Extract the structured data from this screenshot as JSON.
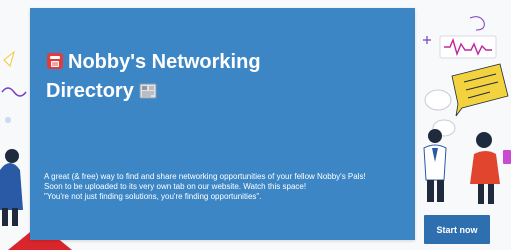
{
  "card": {
    "title": "Nobby's Networking Directory",
    "title_leading_icon": "telephone-icon",
    "title_trailing_icon": "newspaper-icon",
    "description_lines": [
      "A great (& free) way to find and share networking opportunities of your fellow Nobby's Pals!",
      "Soon to be uploaded to its very own tab on our website. Watch this space!",
      "\"You're not just finding solutions, you're finding opportunities\"."
    ]
  },
  "actions": {
    "start_label": "Start now"
  },
  "colors": {
    "card_background": "#3d86c6",
    "button_background": "#2e6fb0",
    "accent_yellow": "#f3d23f",
    "accent_red": "#d9262c",
    "accent_purple": "#7a3dc4"
  },
  "decorations": {
    "icons": [
      "arrow-icon",
      "chat-bubble-icon",
      "sound-wave-icon",
      "person-illustration",
      "paper-plane-icon"
    ]
  }
}
